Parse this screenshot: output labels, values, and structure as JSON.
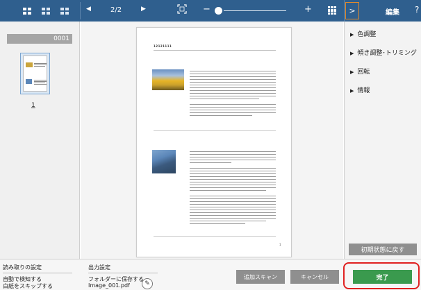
{
  "toolbar": {
    "page_indicator": "2/2",
    "icons": [
      "view-large-thumbs-icon",
      "view-small-thumbs-icon",
      "prev-page-icon",
      "next-page-icon",
      "fit-page-icon",
      "zoom-out-icon",
      "zoom-in-icon",
      "grid-icon"
    ],
    "zoom_minus": "−",
    "zoom_plus": "+",
    "zoom_level": 0.0
  },
  "edit_panel": {
    "toggle": ">",
    "title": "編集",
    "help": "?",
    "items": [
      "色調整",
      "傾き調整･トリミング",
      "回転",
      "情報"
    ],
    "reset_label": "初期状態に戻す"
  },
  "thumbnails": {
    "batch_label": "0001",
    "page_number": "1"
  },
  "page": {
    "header": "12121111",
    "number": "1"
  },
  "bottom": {
    "scan_settings": {
      "title": "読み取りの設定",
      "line1": "自動で検知する",
      "line2": "白紙をスキップする"
    },
    "output_settings": {
      "title": "出力設定",
      "line1": "フォルダーに保存する",
      "line2": "Image_001.pdf"
    },
    "add_scan_label": "追加スキャン",
    "cancel_label": "キャンセル",
    "done_label": "完了"
  },
  "colors": {
    "toolbar": "#2f5f8e",
    "done": "#3a9a4e",
    "highlight": "#e02020"
  }
}
